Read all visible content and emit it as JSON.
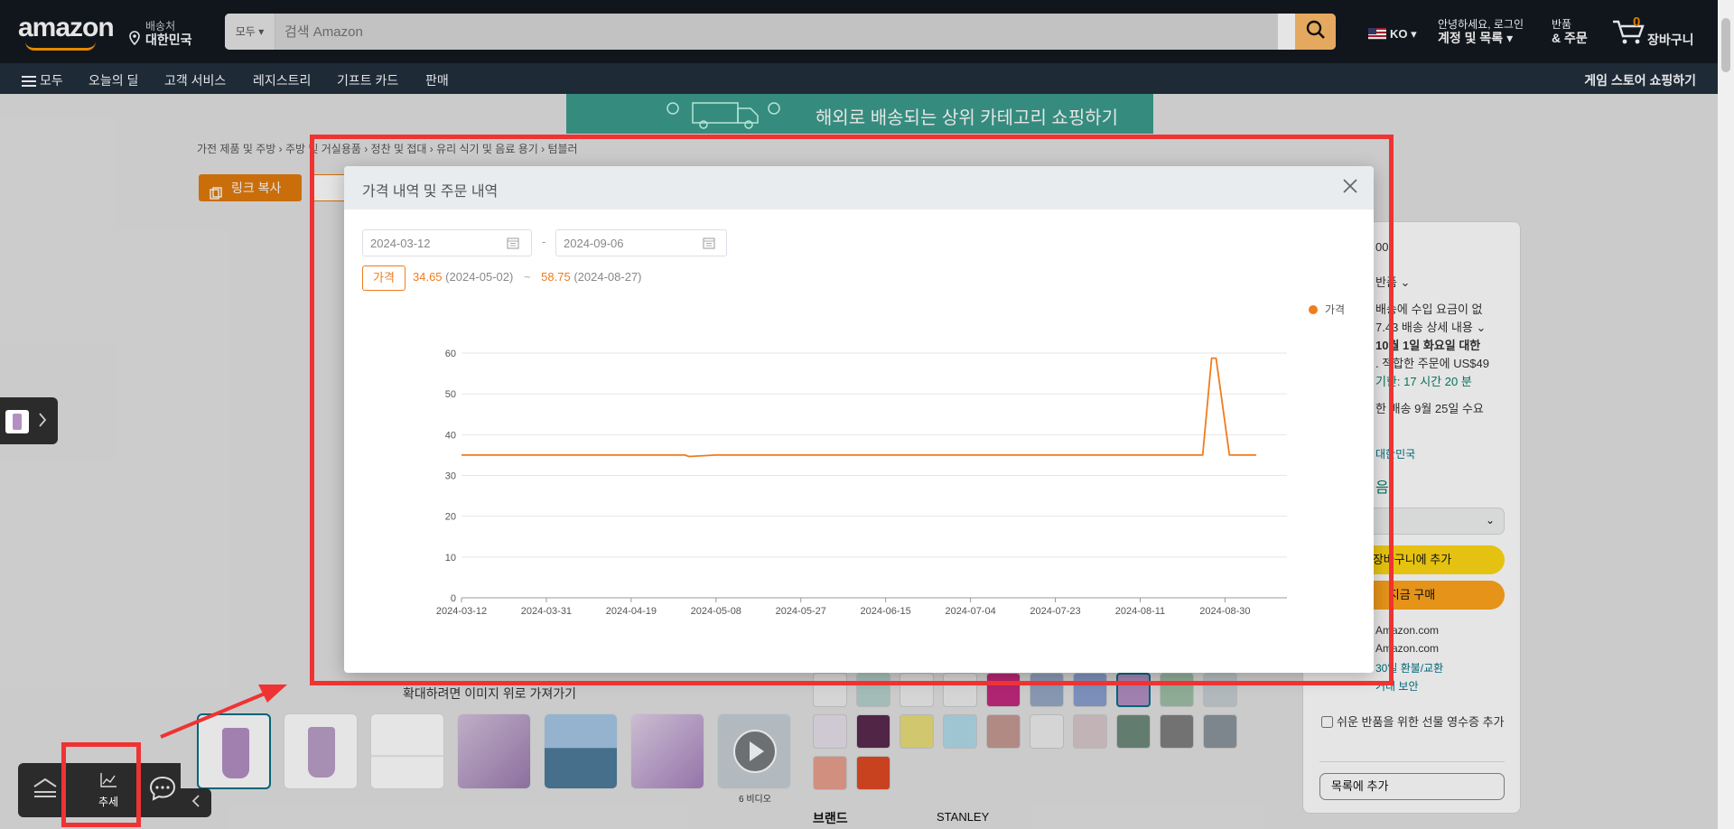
{
  "header": {
    "logo": "amazon",
    "deliver_to_label": "배송처",
    "deliver_to_value": "대한민국",
    "search_category": "모두",
    "search_placeholder": "검색 Amazon",
    "language": "KO",
    "account_greeting": "안녕하세요, 로그인",
    "account_label": "계정 및 목록",
    "orders_line1": "반품",
    "orders_line2": "& 주문",
    "cart_count": "0",
    "cart_label": "장바구니"
  },
  "nav": {
    "menu_label": "모두",
    "items": [
      "오늘의 딜",
      "고객 서비스",
      "레지스트리",
      "기프트 카드",
      "판매"
    ],
    "right_label": "게임 스토어 쇼핑하기"
  },
  "banner": {
    "text": "해외로 배송되는 상위 카테고리 쇼핑하기"
  },
  "breadcrumb": "가전 제품 및 주방 › 주방 및 거실용품 › 정찬 및 접대 › 유리 식기 및 음료 용기 › 텀블러",
  "copy_link_label": "링크 복사",
  "buybox": {
    "lines": [
      {
        "text": "00",
        "top": 20
      },
      {
        "text": "반품 ⌄",
        "top": 56
      },
      {
        "text": "배송에 수입 요금이 없",
        "top": 86
      },
      {
        "text": "7.43 배송 상세 내용 ⌄",
        "top": 106
      },
      {
        "text": "10월 1일 화요일 대한",
        "top": 126
      },
      {
        "text": ". 적합한 주문에 US$49",
        "top": 146
      },
      {
        "text": "기한: 17 시간 20 분",
        "top": 166
      },
      {
        "text": "한 배송 9월 25일 수요",
        "top": 196
      },
      {
        "text": "대한민국",
        "top": 248
      },
      {
        "text": "음",
        "top": 280
      }
    ],
    "add_to_cart": "장바구니에 추가",
    "buy_now": "지금 구매",
    "seller_lines": [
      "Amazon.com",
      "Amazon.com",
      "30일 환불/교환",
      "거래 보안"
    ],
    "gift_label": "쉬운 반품을 위한 선물 영수증 추가",
    "add_to_list": "목록에 추가"
  },
  "product": {
    "zoom_caption": "확대하려면 이미지 위로 가져가기",
    "video_caption": "6 비디오",
    "brand_label": "브랜드",
    "brand_value": "STANLEY"
  },
  "modal": {
    "title": "가격 내역 및 주문 내역",
    "date_from": "2024-03-12",
    "date_to": "2024-09-06",
    "date_separator": "-",
    "price_tag": "가격",
    "min_price": "34.65",
    "min_date": "(2024-05-02)",
    "range_separator": "~",
    "max_price": "58.75",
    "max_date": "(2024-08-27)"
  },
  "toolbar": {
    "trend_label": "추세"
  },
  "colors": {
    "accent": "#f07c1c",
    "annotation": "#ef3333",
    "amazon_dark": "#131921"
  },
  "chart_data": {
    "type": "line",
    "x": [
      "2024-03-12",
      "2024-04-19",
      "2024-05-01",
      "2024-05-02",
      "2024-05-08",
      "2024-08-25",
      "2024-08-27",
      "2024-08-28",
      "2024-08-31",
      "2024-09-06"
    ],
    "series": [
      {
        "name": "가격",
        "values": [
          35,
          35,
          35,
          34.65,
          35,
          35,
          58.75,
          58.75,
          35,
          35
        ]
      }
    ],
    "x_ticks": [
      "2024-03-12",
      "2024-03-31",
      "2024-04-19",
      "2024-05-08",
      "2024-05-27",
      "2024-06-15",
      "2024-07-04",
      "2024-07-23",
      "2024-08-11",
      "2024-08-30"
    ],
    "y_ticks": [
      0,
      10,
      20,
      30,
      40,
      50,
      60
    ],
    "ylim": [
      0,
      60
    ],
    "xlim": [
      "2024-03-12",
      "2024-09-06"
    ],
    "legend": "top-right",
    "grid": true,
    "color": "#f07c1c"
  }
}
